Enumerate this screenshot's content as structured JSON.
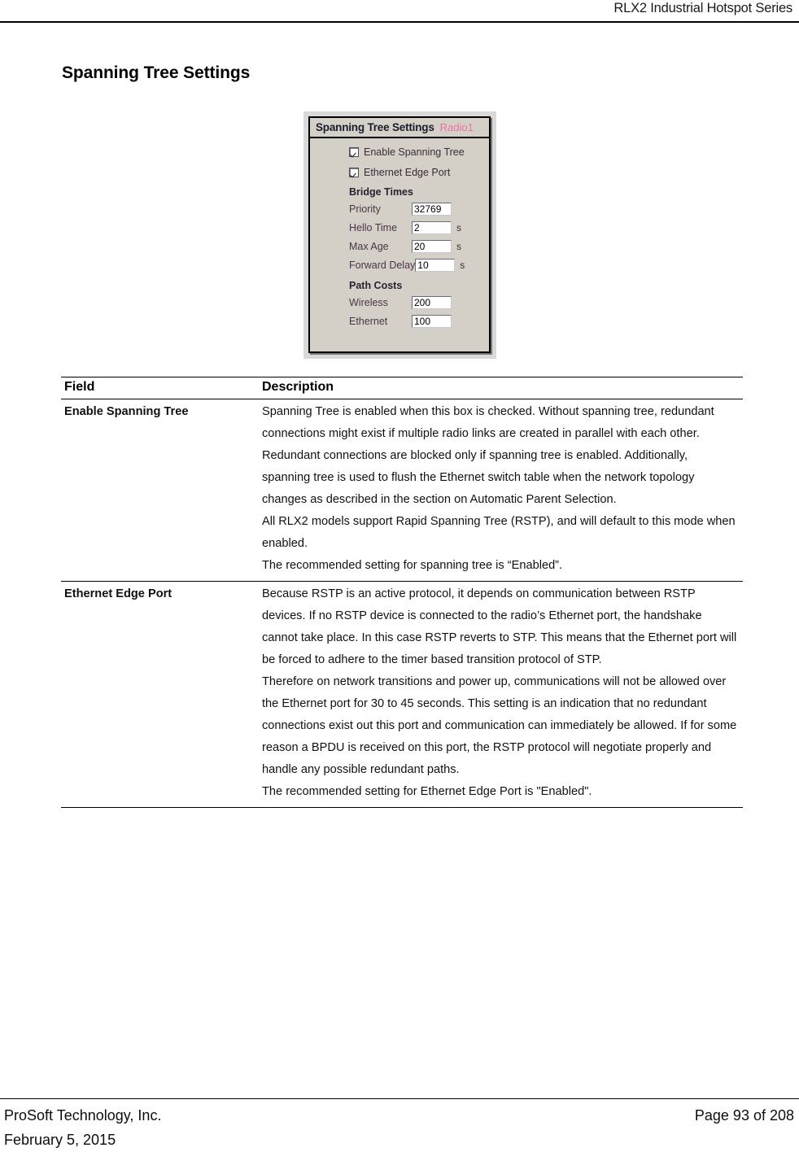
{
  "header": {
    "running_title": "RLX2 Industrial Hotspot Series"
  },
  "section": {
    "title": "Spanning Tree Settings"
  },
  "figure": {
    "panel": {
      "title": "Spanning Tree Settings",
      "radio_label": "Radio1",
      "accent_color": "#f06ea8",
      "background_color": "#d4d0c8",
      "checkboxes": [
        {
          "label": "Enable Spanning Tree",
          "checked": true
        },
        {
          "label": "Ethernet Edge Port",
          "checked": true
        }
      ],
      "groups": [
        {
          "heading": "Bridge Times",
          "fields": [
            {
              "label": "Priority",
              "value": "32769",
              "unit": ""
            },
            {
              "label": "Hello Time",
              "value": "2",
              "unit": "s"
            },
            {
              "label": "Max Age",
              "value": "20",
              "unit": "s"
            },
            {
              "label": "Forward Delay",
              "value": "10",
              "unit": "s"
            }
          ]
        },
        {
          "heading": "Path Costs",
          "fields": [
            {
              "label": "Wireless",
              "value": "200",
              "unit": ""
            },
            {
              "label": "Ethernet",
              "value": "100",
              "unit": ""
            }
          ]
        }
      ]
    }
  },
  "table": {
    "headers": {
      "field": "Field",
      "description": "Description"
    },
    "rows": [
      {
        "field": "Enable Spanning Tree",
        "paragraphs": [
          "Spanning Tree is enabled when this box is checked. Without spanning tree, redundant connections might exist if multiple radio links are created in parallel with each other. Redundant connections are blocked only if spanning tree is enabled. Additionally, spanning tree is used to flush the Ethernet switch table when the network topology changes as described in the section on Automatic Parent Selection.",
          "All RLX2 models support Rapid Spanning Tree (RSTP), and will default to this mode when enabled.",
          "The recommended setting for spanning tree is “Enabled”."
        ]
      },
      {
        "field": "Ethernet Edge Port",
        "paragraphs": [
          "Because RSTP is an active protocol, it depends on communication between RSTP devices. If no RSTP device is connected to the radio’s Ethernet port, the handshake cannot take place. In this case RSTP reverts to STP. This means that the Ethernet port will be forced to adhere to the timer based transition protocol of STP.",
          "Therefore on network transitions and power up, communications will not be allowed over the Ethernet port for 30 to 45 seconds. This setting is an indication that no redundant connections exist out this port and communication can immediately be allowed. If for some reason a BPDU is received on this port, the RSTP protocol will negotiate properly and handle any possible redundant paths.",
          "The recommended setting for Ethernet Edge Port is \"Enabled\"."
        ]
      }
    ]
  },
  "footer": {
    "company": "ProSoft Technology, Inc.",
    "date": "February 5, 2015",
    "page": "Page 93 of 208"
  }
}
